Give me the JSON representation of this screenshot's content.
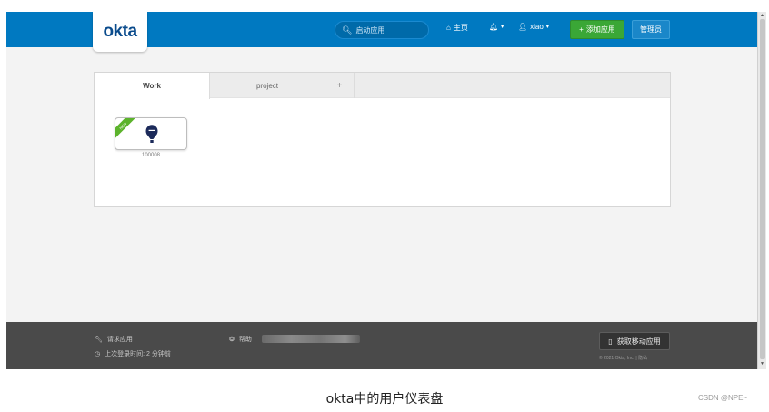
{
  "header": {
    "logo_text": "okta",
    "search_placeholder": "启动应用",
    "home_label": "主页",
    "user_label": "xiao",
    "add_app_label": "添加应用",
    "admin_label": "管理员"
  },
  "dashboard": {
    "tabs": [
      {
        "label": "Work",
        "active": true
      },
      {
        "label": "project",
        "active": false
      },
      {
        "label": "+",
        "active": false
      }
    ],
    "apps": [
      {
        "label": "100008",
        "badge": "NEW",
        "icon": "hot-air-balloon-icon"
      }
    ]
  },
  "footer": {
    "request_app": "请求应用",
    "last_login": "上次登录时间: 2 分钟前",
    "help": "帮助",
    "mobile_app": "获取移动应用",
    "copyright": "© 2021 Okta, Inc.",
    "privacy": "隐私"
  },
  "caption": "okta中的用户仪表盘",
  "watermark": "CSDN @NPE~",
  "colors": {
    "header": "#0079c1",
    "add_button": "#3aa736",
    "footer": "#4a4a4a",
    "background": "#f3f3f3"
  }
}
